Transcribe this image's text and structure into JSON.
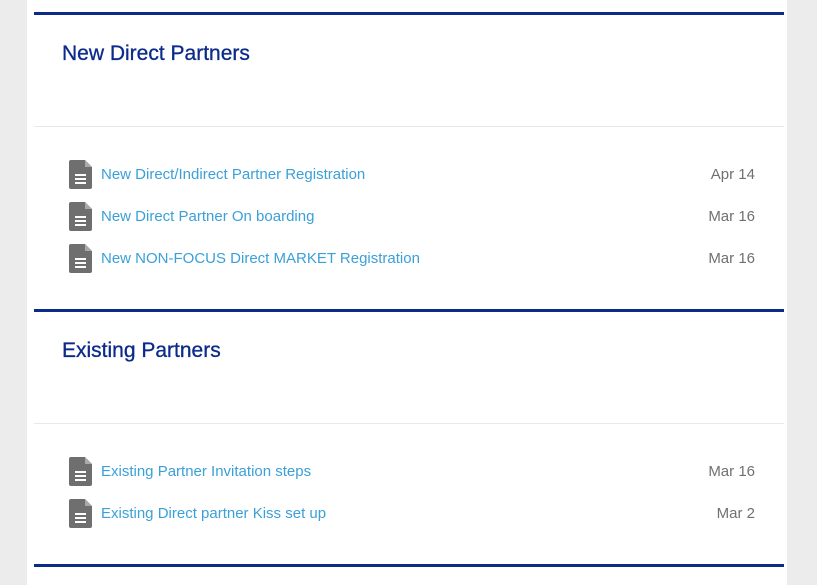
{
  "sections": [
    {
      "title": "New Direct Partners",
      "items": [
        {
          "label": "New Direct/Indirect Partner Registration",
          "date": "Apr 14",
          "icon": "document-icon"
        },
        {
          "label": "New Direct Partner On boarding",
          "date": "Mar 16",
          "icon": "document-icon"
        },
        {
          "label": "New NON-FOCUS Direct MARKET Registration",
          "date": "Mar 16",
          "icon": "document-icon"
        }
      ]
    },
    {
      "title": "Existing Partners",
      "items": [
        {
          "label": "Existing Partner Invitation steps",
          "date": "Mar 16",
          "icon": "document-icon"
        },
        {
          "label": "Existing Direct partner Kiss set up",
          "date": "Mar 2",
          "icon": "document-icon"
        }
      ]
    }
  ],
  "colors": {
    "accent": "#0b2a8a",
    "link": "#3aa0d8",
    "date": "#707070",
    "icon": "#6f6f6f"
  }
}
